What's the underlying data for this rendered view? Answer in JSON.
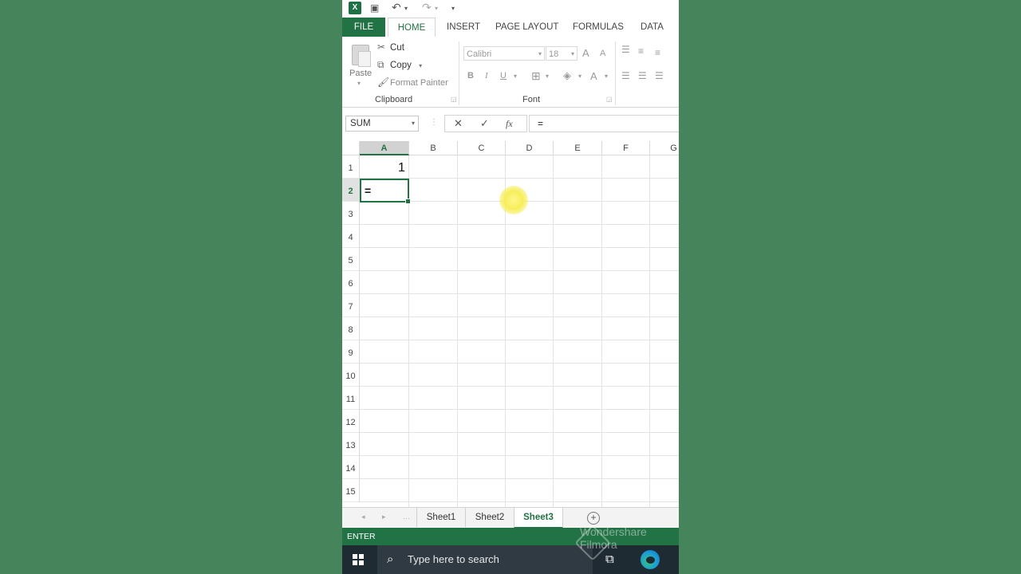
{
  "quick_access": {
    "undo_icon": "undo-icon",
    "redo_icon": "redo-icon",
    "save_icon": "save-icon"
  },
  "tabs": [
    "FILE",
    "HOME",
    "INSERT",
    "PAGE LAYOUT",
    "FORMULAS",
    "DATA"
  ],
  "clipboard": {
    "paste": "Paste",
    "cut": "Cut",
    "copy": "Copy",
    "format_painter": "Format Painter",
    "group_label": "Clipboard"
  },
  "font": {
    "font_name": "Calibri",
    "font_size": "18",
    "group_label": "Font",
    "bold": "B",
    "italic": "I",
    "underline": "U",
    "grow": "A",
    "shrink": "A",
    "font_color": "A"
  },
  "formula_bar": {
    "name_box": "SUM",
    "cancel": "✕",
    "enter": "✓",
    "fx": "fx",
    "content": "="
  },
  "columns": [
    "A",
    "B",
    "C",
    "D",
    "E",
    "F",
    "G"
  ],
  "rows": [
    "1",
    "2",
    "3",
    "4",
    "5",
    "6",
    "7",
    "8",
    "9",
    "10",
    "11",
    "12",
    "13",
    "14",
    "15"
  ],
  "cells": {
    "A1": "1",
    "A2": "="
  },
  "sheets": [
    "Sheet1",
    "Sheet2",
    "Sheet3"
  ],
  "status": "ENTER",
  "taskbar": {
    "search_placeholder": "Type here to search"
  },
  "watermark": {
    "line1": "Wondershare",
    "line2": "Filmora"
  },
  "colors": {
    "excel_green": "#217346",
    "background": "#46855b"
  }
}
